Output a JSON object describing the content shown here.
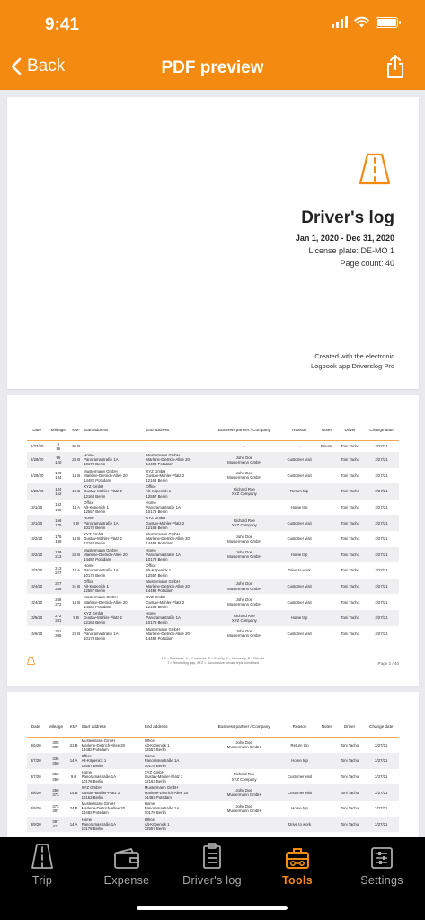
{
  "status_bar": {
    "time": "9:41"
  },
  "nav": {
    "back_label": "Back",
    "title": "PDF preview"
  },
  "colors": {
    "accent": "#f58a10",
    "tabbar_bg": "#000000",
    "inactive": "#aaaaaa"
  },
  "cover": {
    "title": "Driver's log",
    "period": "Jan 1, 2020 - Dec 31, 2020",
    "license_plate": "License plate: DE-MO 1",
    "page_count": "Page count: 40",
    "credit_line1": "Created with the electronic",
    "credit_line2": "Logbook app Driverslog Pro"
  },
  "log_table": {
    "headers": [
      "Date",
      "Mileage",
      "KM*",
      "Start address",
      "End address",
      "Business partner / Company",
      "Reason",
      "Notes",
      "Driver",
      "Change date"
    ],
    "page1_rows": [
      [
        "2/27/20",
        "0\n96",
        "96 P",
        "-",
        "-",
        "-",
        "-",
        "Private",
        "Toni Tacho",
        "2/27/21"
      ],
      [
        "2/28/20",
        "96\n120",
        "24 B",
        "Home\nPanoramastraße 1A\n10178 Berlin",
        "Mustermann GmbH\nMarlene-Dietrich-Allee 20\n14482 Potsdam",
        "John Doe\nMustermann GmbH",
        "Customer visit",
        "",
        "Toni Tacho",
        "2/27/21"
      ],
      [
        "2/29/20",
        "120\n134",
        "14 B",
        "Mustermann GmbH\nMarlene-Dietrich-Allee 20\n14482 Potsdam",
        "XYZ GmbH\nGustav-Mahler-Platz 2\n12163 Berlin",
        "John Doe\nMustermann GmbH",
        "Customer visit",
        "",
        "Toni Tacho",
        "2/27/21"
      ],
      [
        "2/29/20",
        "134\n152",
        "18 B",
        "XYZ GmbH\nGustav-Mahler-Platz 2\n12163 Berlin",
        "Office\nAlt-Köpenick 1\n12557 Berlin",
        "Richard Roe\nXYZ Company",
        "Return trip",
        "",
        "Toni Tacho",
        "2/27/21"
      ],
      [
        "3/1/20",
        "152\n166",
        "14 A",
        "Office\nAlt-Köpenick 1\n12557 Berlin",
        "Home\nPanoramastraße 1A\n10178 Berlin",
        "",
        "Home trip",
        "",
        "Toni Tacho",
        "2/27/21"
      ],
      [
        "3/1/20",
        "166\n175",
        "9 B",
        "Home\nPanoramastraße 1A\n10178 Berlin",
        "XYZ GmbH\nGustav-Mahler-Platz 2\n12163 Berlin",
        "Richard Roe\nXYZ Company",
        "Customer visit",
        "",
        "Toni Tacho",
        "2/27/21"
      ],
      [
        "3/2/20",
        "175\n189",
        "14 B",
        "XYZ GmbH\nGustav-Mahler-Platz 2\n12163 Berlin",
        "Mustermann GmbH\nMarlene-Dietrich-Allee 20\n14482 Potsdam",
        "John Doe\nMustermann GmbH",
        "Customer visit",
        "",
        "Toni Tacho",
        "2/27/21"
      ],
      [
        "3/2/20",
        "189\n213",
        "24 B",
        "Mustermann GmbH\nMarlene-Dietrich-Allee 20\n14482 Potsdam",
        "Home\nPanoramastraße 1A\n10178 Berlin",
        "John Doe\nMustermann GmbH",
        "Home trip",
        "",
        "Toni Tacho",
        "2/27/21"
      ],
      [
        "3/3/20",
        "213\n227",
        "14 A",
        "Home\nPanoramastraße 1A\n10178 Berlin",
        "Office\nAlt-Köpenick 1\n12557 Berlin",
        "",
        "Drive to work",
        "",
        "Toni Tacho",
        "2/27/21"
      ],
      [
        "3/4/20",
        "227\n258",
        "31 B",
        "Office\nAlt-Köpenick 1\n12557 Berlin",
        "Mustermann GmbH\nMarlene-Dietrich-Allee 20\n14482 Potsdam",
        "John Doe\nMustermann GmbH",
        "Customer visit",
        "",
        "Toni Tacho",
        "2/27/21"
      ],
      [
        "3/4/20",
        "258\n272",
        "14 B",
        "Mustermann GmbH\nMarlene-Dietrich-Allee 20\n14482 Potsdam",
        "XYZ GmbH\nGustav-Mahler-Platz 2\n12163 Berlin",
        "John Doe\nMustermann GmbH",
        "Customer visit",
        "",
        "Toni Tacho",
        "2/27/21"
      ],
      [
        "3/5/20",
        "272\n281",
        "9 B",
        "XYZ GmbH\nGustav-Mahler-Platz 2\n12163 Berlin",
        "Home\nPanoramastraße 1A\n10178 Berlin",
        "Richard Roe\nXYZ Company",
        "Home trip",
        "",
        "Toni Tacho",
        "2/27/21"
      ],
      [
        "3/6/20",
        "281\n305",
        "24 B",
        "Home\nPanoramastraße 1A\n10178 Berlin",
        "Mustermann GmbH\nMarlene-Dietrich-Allee 20\n14482 Potsdam",
        "John Doe\nMustermann GmbH",
        "Customer visit",
        "",
        "Toni Tacho",
        "2/27/21"
      ]
    ],
    "page2_rows": [
      [
        "3/6/20",
        "305\n336",
        "31 B",
        "Mustermann GmbH\nMarlene-Dietrich-Allee 20\n14482 Potsdam",
        "Office\nAlt-Köpenick 1\n12557 Berlin",
        "John Doe\nMustermann GmbH",
        "Return trip",
        "",
        "Toni Tacho",
        "2/27/21"
      ],
      [
        "3/7/20",
        "336\n350",
        "14 A",
        "Office\nAlt-Köpenick 1\n12557 Berlin",
        "Home\nPanoramastraße 1A\n10178 Berlin",
        "",
        "Home trip",
        "",
        "Toni Tacho",
        "2/27/21"
      ],
      [
        "3/7/20",
        "350\n359",
        "9 B",
        "Home\nPanoramastraße 1A\n10178 Berlin",
        "XYZ GmbH\nGustav-Mahler-Platz 2\n12163 Berlin",
        "Richard Roe\nXYZ Company",
        "Customer visit",
        "",
        "Toni Tacho",
        "2/27/21"
      ],
      [
        "3/8/20",
        "359\n373",
        "14 B",
        "XYZ GmbH\nGustav-Mahler-Platz 2\n12163 Berlin",
        "Mustermann GmbH\nMarlene-Dietrich-Allee 20\n14482 Potsdam",
        "John Doe\nMustermann GmbH",
        "Customer visit",
        "",
        "Toni Tacho",
        "2/27/21"
      ],
      [
        "3/9/20",
        "373\n397",
        "24 B",
        "Mustermann GmbH\nMarlene-Dietrich-Allee 20\n14482 Potsdam",
        "Home\nPanoramastraße 1A\n10178 Berlin",
        "John Doe\nMustermann GmbH",
        "Home trip",
        "",
        "Toni Tacho",
        "2/27/21"
      ],
      [
        "3/9/20",
        "397\n411",
        "14 A",
        "Home\nPanoramastraße 1A\n10178 Berlin",
        "Office\nAlt-Köpenick 1\n12557 Berlin",
        "",
        "Drive to work",
        "",
        "Toni Tacho",
        "2/27/21"
      ]
    ],
    "footnote_line1": "* B = Business, A = Commute, F = Family, E = Honorary, P = Private",
    "footnote_line2": "T = Recording gap, AFZ = Successive private trips combined",
    "page_label": "Page 2 / 40"
  },
  "tabs": [
    {
      "label": "Trip",
      "icon": "road-icon",
      "active": false
    },
    {
      "label": "Expense",
      "icon": "wallet-icon",
      "active": false
    },
    {
      "label": "Driver's log",
      "icon": "clipboard-icon",
      "active": false
    },
    {
      "label": "Tools",
      "icon": "toolbox-icon",
      "active": true
    },
    {
      "label": "Settings",
      "icon": "sliders-icon",
      "active": false
    }
  ]
}
